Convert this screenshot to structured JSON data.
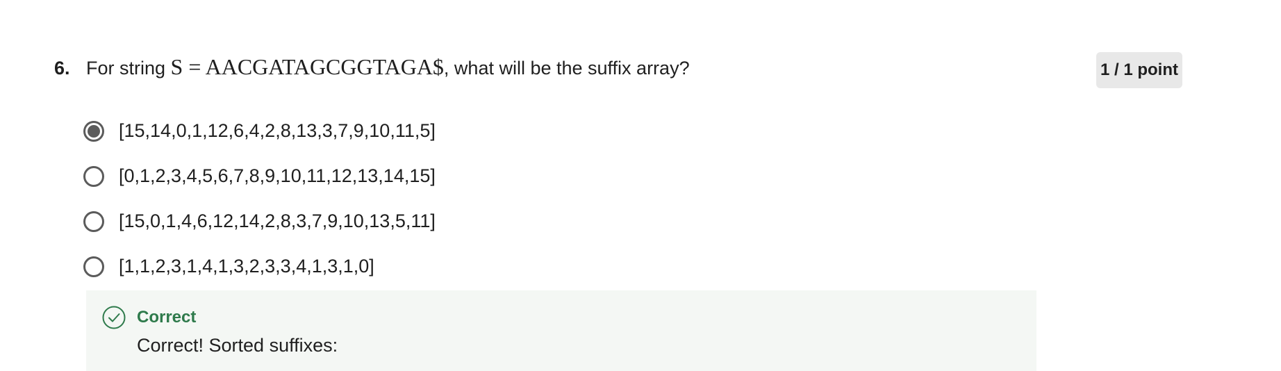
{
  "question": {
    "number": "6.",
    "text_before": "For string ",
    "math_expression": "S = AACGATAGCGGTAGA$",
    "text_after": ", what will be the suffix array?"
  },
  "score": {
    "label": "1 / 1 point"
  },
  "options": [
    {
      "label": "[15,14,0,1,12,6,4,2,8,13,3,7,9,10,11,5]",
      "selected": true
    },
    {
      "label": "[0,1,2,3,4,5,6,7,8,9,10,11,12,13,14,15]",
      "selected": false
    },
    {
      "label": "[15,0,1,4,6,12,14,2,8,3,7,9,10,13,5,11]",
      "selected": false
    },
    {
      "label": "[1,1,2,3,1,4,1,3,2,3,3,4,1,3,1,0]",
      "selected": false
    }
  ],
  "feedback": {
    "status": "Correct",
    "message": "Correct! Sorted suffixes:",
    "icon": "check-circle-icon",
    "status_color": "#2e7a4b"
  }
}
